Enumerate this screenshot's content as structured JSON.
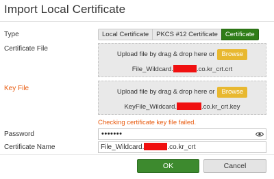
{
  "dialog": {
    "title": "Import Local Certificate"
  },
  "type": {
    "label": "Type",
    "options": [
      "Local Certificate",
      "PKCS #12 Certificate",
      "Certificate"
    ],
    "selected": "Certificate"
  },
  "certificate_file": {
    "label": "Certificate File",
    "upload_text": "Upload file by drag & drop here or",
    "browse_label": "Browse",
    "filename_prefix": "File_Wildcard.",
    "filename_suffix": ".co.kr_crt.crt"
  },
  "key_file": {
    "label": "Key File",
    "upload_text": "Upload file by drag & drop here or",
    "browse_label": "Browse",
    "filename_prefix": "KeyFile_Wildcard.",
    "filename_suffix": ".co.kr_crt.key",
    "error_message": "Checking certificate key file failed."
  },
  "password": {
    "label": "Password",
    "masked_value": "•••••••"
  },
  "certificate_name": {
    "label": "Certificate Name",
    "value_prefix": "File_Wildcard.",
    "value_suffix": ".co.kr_crt"
  },
  "footer": {
    "ok_label": "OK",
    "cancel_label": "Cancel"
  },
  "colors": {
    "accent_green": "#3d8a2e",
    "browse_yellow": "#e8b830",
    "error_orange": "#e8590c",
    "redaction_red": "#f01010"
  }
}
